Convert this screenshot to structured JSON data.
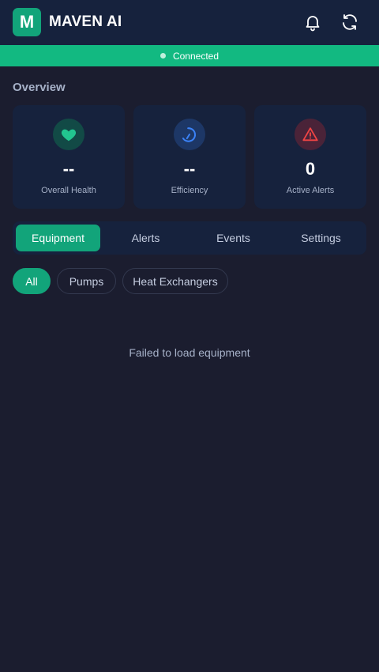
{
  "header": {
    "logo_letter": "M",
    "title": "MAVEN AI",
    "icons": {
      "notifications": "bell-icon",
      "refresh": "refresh-icon"
    }
  },
  "status": {
    "text": "Connected",
    "color": "#12b981"
  },
  "overview": {
    "title": "Overview",
    "cards": [
      {
        "value": "--",
        "label": "Overall Health",
        "icon": "heart-icon",
        "color": "#22c58f"
      },
      {
        "value": "--",
        "label": "Efficiency",
        "icon": "gauge-icon",
        "color": "#3b82f6"
      },
      {
        "value": "0",
        "label": "Active Alerts",
        "icon": "warning-icon",
        "color": "#ef4444"
      }
    ]
  },
  "tabs": [
    {
      "label": "Equipment",
      "active": true
    },
    {
      "label": "Alerts",
      "active": false
    },
    {
      "label": "Events",
      "active": false
    },
    {
      "label": "Settings",
      "active": false
    }
  ],
  "filters": [
    {
      "label": "All",
      "active": true
    },
    {
      "label": "Pumps",
      "active": false
    },
    {
      "label": "Heat Exchangers",
      "active": false
    }
  ],
  "empty_state": {
    "message": "Failed to load equipment"
  },
  "colors": {
    "accent": "#12a47a",
    "background": "#1b1d2f",
    "surface": "#16223d"
  }
}
